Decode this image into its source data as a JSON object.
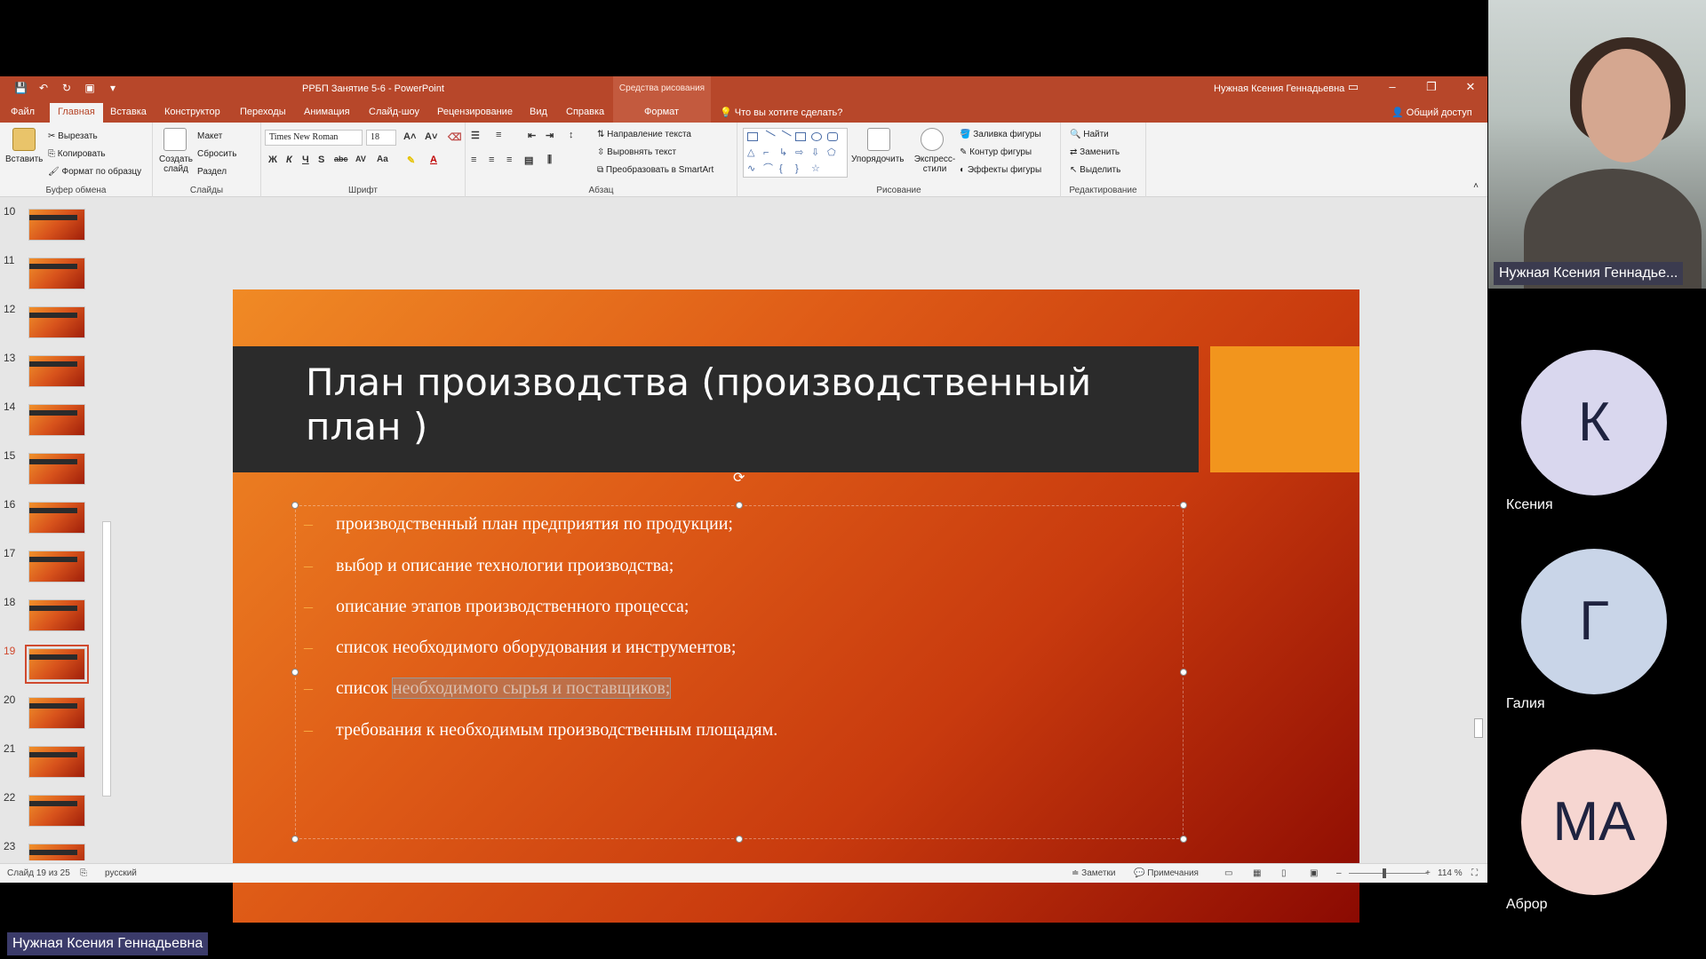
{
  "window": {
    "title": "РРБП Занятие 5-6  -  PowerPoint",
    "context_group": "Средства рисования",
    "user": "Нужная Ксения Геннадьевна",
    "controls": [
      "–",
      "❐",
      "✕"
    ]
  },
  "tabs": {
    "file": "Файл",
    "home": "Главная",
    "insert": "Вставка",
    "design": "Конструктор",
    "transitions": "Переходы",
    "animations": "Анимация",
    "slideshow": "Слайд-шоу",
    "review": "Рецензирование",
    "view": "Вид",
    "help": "Справка",
    "format": "Формат",
    "tellme": "Что вы хотите сделать?",
    "share": "Общий доступ"
  },
  "ribbon": {
    "clipboard": {
      "label": "Буфер обмена",
      "paste": "Вставить",
      "cut": "Вырезать",
      "copy": "Копировать",
      "format_painter": "Формат по образцу"
    },
    "slides": {
      "label": "Слайды",
      "new_slide": "Создать слайд",
      "layout": "Макет",
      "reset": "Сбросить",
      "section": "Раздел"
    },
    "font": {
      "label": "Шрифт",
      "name": "Times New Roman",
      "size": "18"
    },
    "paragraph": {
      "label": "Абзац",
      "text_direction": "Направление текста",
      "align_text": "Выровнять текст",
      "smartart": "Преобразовать в SmartArt"
    },
    "drawing": {
      "label": "Рисование",
      "arrange": "Упорядочить",
      "quick_styles": "Экспресс-стили",
      "fill": "Заливка фигуры",
      "outline": "Контур фигуры",
      "effects": "Эффекты фигуры"
    },
    "editing": {
      "label": "Редактирование",
      "find": "Найти",
      "replace": "Заменить",
      "select": "Выделить"
    }
  },
  "thumbnails": [
    {
      "num": "10"
    },
    {
      "num": "11"
    },
    {
      "num": "12"
    },
    {
      "num": "13"
    },
    {
      "num": "14"
    },
    {
      "num": "15"
    },
    {
      "num": "16"
    },
    {
      "num": "17"
    },
    {
      "num": "18"
    },
    {
      "num": "19"
    },
    {
      "num": "20"
    },
    {
      "num": "21"
    },
    {
      "num": "22"
    },
    {
      "num": "23"
    }
  ],
  "selected_slide": "19",
  "slide": {
    "title": "План производства (производственный план )",
    "bullets": [
      "производственный план предприятия по продукции;",
      "выбор и описание технологии производства;",
      "описание этапов производственного процесса;",
      "список необходимого оборудования и инструментов;",
      "список необходимого сырья и поставщиков;",
      "требования к необходимым производственным площадям."
    ],
    "bullet5_prefix": "список ",
    "bullet5_selected": "необходимого сырья и поставщиков;",
    "dash": "–"
  },
  "statusbar": {
    "slide_count": "Слайд 19 из 25",
    "language": "русский",
    "notes": "Заметки",
    "comments": "Примечания",
    "zoom": "114 %"
  },
  "meeting": {
    "presenter_label": "Нужная Ксения Геннадье...",
    "participants": [
      {
        "initials": "К",
        "name": "Ксения",
        "color": "#d9d7ee"
      },
      {
        "initials": "Г",
        "name": "Галия",
        "color": "#c9d5e8"
      },
      {
        "initials": "МА",
        "name": "Аброр",
        "color": "#f6d6d1"
      }
    ],
    "bottom_label": "Нужная Ксения Геннадьевна"
  }
}
